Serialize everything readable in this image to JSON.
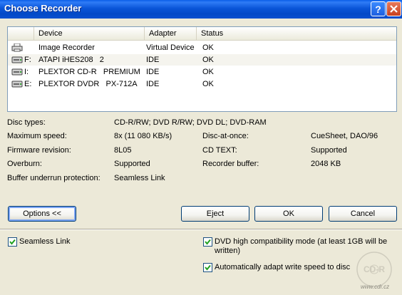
{
  "window": {
    "title": "Choose Recorder"
  },
  "list": {
    "columns": [
      "Device",
      "Adapter",
      "Status"
    ],
    "rows": [
      {
        "drive": "",
        "device": "Image Recorder",
        "adapter": "Virtual Device",
        "status": "OK",
        "icon": "printer-icon"
      },
      {
        "drive": "F:",
        "device": "ATAPI iHES208   2",
        "adapter": "IDE",
        "status": "OK",
        "icon": "cd-drive-icon"
      },
      {
        "drive": "I:",
        "device": "PLEXTOR CD-R   PREMIUM",
        "adapter": "IDE",
        "status": "OK",
        "icon": "cd-drive-icon"
      },
      {
        "drive": "E:",
        "device": "PLEXTOR DVDR   PX-712A",
        "adapter": "IDE",
        "status": "OK",
        "icon": "cd-drive-icon"
      }
    ]
  },
  "info": {
    "disc_types_label": "Disc types:",
    "disc_types_value": "CD-R/RW; DVD R/RW; DVD DL; DVD-RAM",
    "max_speed_label": "Maximum speed:",
    "max_speed_value": "8x (11 080 KB/s)",
    "dao_label": "Disc-at-once:",
    "dao_value": "CueSheet, DAO/96",
    "firmware_label": "Firmware revision:",
    "firmware_value": "8L05",
    "cdtext_label": "CD TEXT:",
    "cdtext_value": "Supported",
    "overburn_label": "Overburn:",
    "overburn_value": "Supported",
    "buffer_label": "Recorder buffer:",
    "buffer_value": "2048 KB",
    "underrun_label": "Buffer underrun protection:",
    "underrun_value": "Seamless Link"
  },
  "buttons": {
    "options": "Options <<",
    "eject": "Eject",
    "ok": "OK",
    "cancel": "Cancel"
  },
  "options": {
    "seamless_link": {
      "label": "Seamless Link",
      "checked": true
    },
    "dvd_compat": {
      "label": "DVD high compatibility mode (at least 1GB will be written)",
      "checked": true
    },
    "auto_speed": {
      "label": "Automatically adapt write speed to disc",
      "checked": true
    }
  },
  "watermark": {
    "logo_text": "CD-R",
    "site": "www.cdr.cz"
  }
}
